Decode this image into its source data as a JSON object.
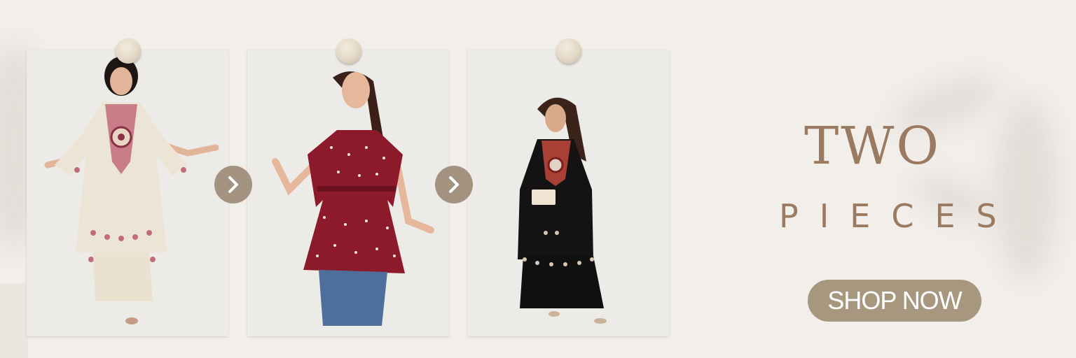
{
  "banner": {
    "headline_line1": "TWO",
    "headline_line2": "PIECES",
    "cta_label": "SHOP NOW"
  },
  "carousel": {
    "items": [
      {
        "product": "cream-embroidered-kurta-set",
        "dress_color": "#ece4d4",
        "accent_color": "#c26b7b"
      },
      {
        "product": "maroon-polka-top",
        "dress_color": "#8c1a2a",
        "accent_color": "#f1e6e2"
      },
      {
        "product": "black-embroidered-kurta-set",
        "dress_color": "#141212",
        "accent_color": "#b8463a"
      }
    ],
    "next_icon": "chevron-right-icon"
  },
  "colors": {
    "background": "#f2eeea",
    "text_accent": "#9a7a61",
    "button": "#a7977f",
    "arrow_button": "#a39380"
  }
}
